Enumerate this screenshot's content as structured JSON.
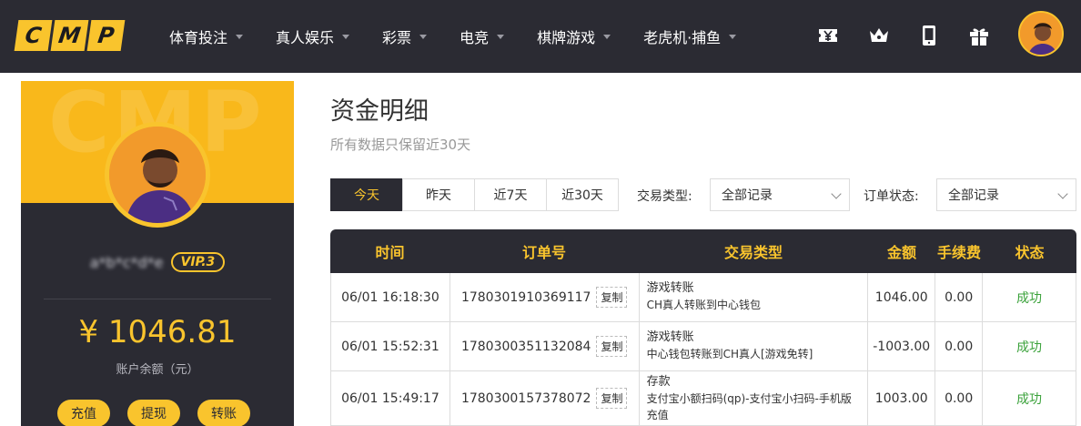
{
  "logo": [
    "C",
    "M",
    "P"
  ],
  "nav": {
    "items": [
      {
        "label": "体育投注"
      },
      {
        "label": "真人娱乐"
      },
      {
        "label": "彩票"
      },
      {
        "label": "电竞"
      },
      {
        "label": "棋牌游戏"
      },
      {
        "label": "老虎机·捕鱼"
      }
    ],
    "icons": [
      "yen-ticket-icon",
      "crown-icon",
      "mobile-icon",
      "gift-icon"
    ]
  },
  "sidebar": {
    "watermark": "CMP",
    "username": "a*b*c*d*e",
    "vip": "VIP.3",
    "balance": "¥ 1046.81",
    "balance_label": "账户余额（元）",
    "buttons": [
      "充值",
      "提现",
      "转账"
    ]
  },
  "main": {
    "title": "资金明细",
    "subtitle": "所有数据只保留近30天",
    "date_tabs": [
      "今天",
      "昨天",
      "近7天",
      "近30天"
    ],
    "active_tab": 0,
    "filter_type_label": "交易类型:",
    "filter_type_value": "全部记录",
    "filter_status_label": "订单状态:",
    "filter_status_value": "全部记录"
  },
  "table": {
    "headers": [
      "时间",
      "订单号",
      "交易类型",
      "金额",
      "手续费",
      "状态"
    ],
    "copy_label": "复制",
    "rows": [
      {
        "time": "06/01 16:18:30",
        "order": "1780301910369117",
        "type": "游戏转账",
        "type_detail": "CH真人转账到中心钱包",
        "amount": "1046.00",
        "fee": "0.00",
        "status": "成功"
      },
      {
        "time": "06/01 15:52:31",
        "order": "1780300351132084",
        "type": "游戏转账",
        "type_detail": "中心钱包转账到CH真人[游戏免转]",
        "amount": "-1003.00",
        "fee": "0.00",
        "status": "成功"
      },
      {
        "time": "06/01 15:49:17",
        "order": "1780300157378072",
        "type": "存款",
        "type_detail": "支付宝小额扫码(qp)-支付宝小扫码-手机版 充值",
        "amount": "1003.00",
        "fee": "0.00",
        "status": "成功"
      }
    ]
  },
  "colors": {
    "dark": "#2b2b33",
    "accent": "#f9c42d",
    "success": "#3ba23b"
  }
}
